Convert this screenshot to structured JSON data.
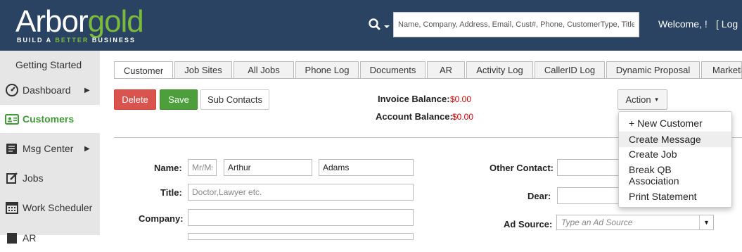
{
  "header": {
    "logo_text_white": "Arbor",
    "logo_text_green": "gold",
    "logo_tagline_1": "BUILD A",
    "logo_tagline_2": "BETTER",
    "logo_tagline_3": "BUSINESS",
    "search_placeholder": "Name, Company, Address, Email, Cust#, Phone, CustomerType, Title",
    "welcome": "Welcome, !",
    "login": "[ Log"
  },
  "sidebar": {
    "items": [
      {
        "label": "Getting Started"
      },
      {
        "label": "Dashboard"
      },
      {
        "label": "Customers"
      },
      {
        "label": "Msg Center"
      },
      {
        "label": "Jobs"
      },
      {
        "label": "Work Scheduler"
      },
      {
        "label": "AR"
      }
    ]
  },
  "tabs": [
    "Customer",
    "Job Sites",
    "All Jobs",
    "Phone Log",
    "Documents",
    "AR",
    "Activity Log",
    "CallerID Log",
    "Dynamic Proposal",
    "Marketi"
  ],
  "toolbar": {
    "delete": "Delete",
    "save": "Save",
    "sub_contacts": "Sub Contacts",
    "action": "Action"
  },
  "balances": {
    "invoice_label": "Invoice Balance:",
    "invoice_value": "$0.00",
    "account_label": "Account Balance:",
    "account_value": "$0.00"
  },
  "form": {
    "name_label": "Name:",
    "salutation_placeholder": "Mr/Ms",
    "first_name": "Arthur",
    "last_name": "Adams",
    "title_label": "Title:",
    "title_placeholder": "Doctor,Lawyer etc.",
    "company_label": "Company:",
    "other_contact_label": "Other Contact:",
    "dear_label": "Dear:",
    "ad_source_label": "Ad Source:",
    "ad_source_placeholder": "Type an Ad Source"
  },
  "action_menu": {
    "items": [
      "+ New Customer",
      "Create Message",
      "Create Job",
      "Break QB Association",
      "Print Statement"
    ]
  },
  "colors": {
    "header_bg": "#2b4363",
    "brand_green": "#7cba3c",
    "delete_red": "#d9534f",
    "save_green": "#4c9f3b"
  }
}
